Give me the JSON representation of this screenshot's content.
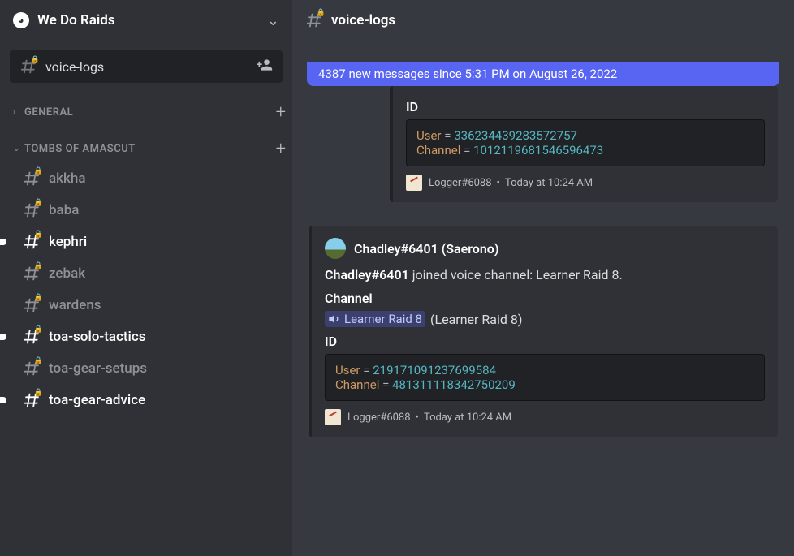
{
  "server": {
    "name": "We Do Raids"
  },
  "current_channel": "voice-logs",
  "search": {
    "text": "voice-logs"
  },
  "categories": [
    {
      "name": "GENERAL",
      "collapsed": true,
      "channels": []
    },
    {
      "name": "TOMBS OF AMASCUT",
      "collapsed": false,
      "channels": [
        {
          "name": "akkha",
          "unread": false
        },
        {
          "name": "baba",
          "unread": false
        },
        {
          "name": "kephri",
          "unread": true
        },
        {
          "name": "zebak",
          "unread": false
        },
        {
          "name": "wardens",
          "unread": false
        },
        {
          "name": "toa-solo-tactics",
          "unread": true
        },
        {
          "name": "toa-gear-setups",
          "unread": false
        },
        {
          "name": "toa-gear-advice",
          "unread": true
        }
      ]
    }
  ],
  "new_messages_bar": "4387 new messages since 5:31 PM on August 26, 2022",
  "embeds": [
    {
      "partial_top": true,
      "id_label": "ID",
      "user_id": "336234439283572757",
      "channel_id": "1012119681546596473",
      "footer_name": "Logger#6088",
      "footer_time": "Today at 10:24 AM"
    },
    {
      "author": "Chadley#6401 (Saerono)",
      "desc_bold": "Chadley#6401",
      "desc_rest": " joined voice channel: Learner Raid 8.",
      "channel_label": "Channel",
      "vc_name": "Learner Raid 8",
      "vc_paren": "(Learner Raid 8)",
      "id_label": "ID",
      "user_id": "219171091237699584",
      "channel_id": "481311118342750209",
      "footer_name": "Logger#6088",
      "footer_time": "Today at 10:24 AM"
    }
  ],
  "code_labels": {
    "user": "User",
    "channel": "Channel",
    "eq": " = "
  }
}
